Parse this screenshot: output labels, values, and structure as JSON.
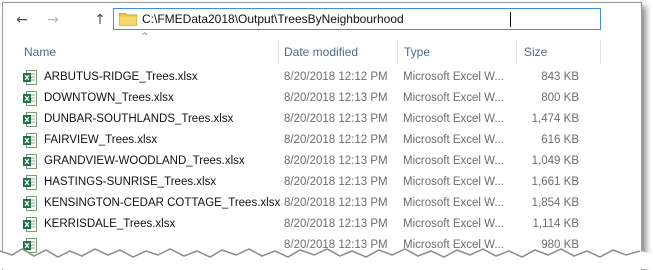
{
  "address": {
    "path": "C:\\FMEData2018\\Output\\TreesByNeighbourhood"
  },
  "nav": {
    "back": "←",
    "forward": "→",
    "up": "↑"
  },
  "columns": {
    "sort_indicator": "^",
    "name": "Name",
    "date": "Date modified",
    "type": "Type",
    "size": "Size"
  },
  "files": [
    {
      "name": "ARBUTUS-RIDGE_Trees.xlsx",
      "date": "8/20/2018 12:12 PM",
      "type": "Microsoft Excel W...",
      "size": "843 KB"
    },
    {
      "name": "DOWNTOWN_Trees.xlsx",
      "date": "8/20/2018 12:13 PM",
      "type": "Microsoft Excel W...",
      "size": "800 KB"
    },
    {
      "name": "DUNBAR-SOUTHLANDS_Trees.xlsx",
      "date": "8/20/2018 12:13 PM",
      "type": "Microsoft Excel W...",
      "size": "1,474 KB"
    },
    {
      "name": "FAIRVIEW_Trees.xlsx",
      "date": "8/20/2018 12:12 PM",
      "type": "Microsoft Excel W...",
      "size": "616 KB"
    },
    {
      "name": "GRANDVIEW-WOODLAND_Trees.xlsx",
      "date": "8/20/2018 12:13 PM",
      "type": "Microsoft Excel W...",
      "size": "1,049 KB"
    },
    {
      "name": "HASTINGS-SUNRISE_Trees.xlsx",
      "date": "8/20/2018 12:13 PM",
      "type": "Microsoft Excel W...",
      "size": "1,661 KB"
    },
    {
      "name": "KENSINGTON-CEDAR COTTAGE_Trees.xlsx",
      "date": "8/20/2018 12:13 PM",
      "type": "Microsoft Excel W...",
      "size": "1,854 KB"
    },
    {
      "name": "KERRISDALE_Trees.xlsx",
      "date": "8/20/2018 12:13 PM",
      "type": "Microsoft Excel W...",
      "size": "1,114 KB"
    },
    {
      "name": "",
      "date": "8/20/2018 12:13 PM",
      "type": "Microsoft Excel W...",
      "size": "980 KB"
    }
  ],
  "colors": {
    "excel_green": "#1e7145",
    "folder_yellow": "#f3c94c",
    "accent_blue": "#3d8ee6"
  },
  "icons": {
    "folder": "folder-icon",
    "excel": "excel-file-icon"
  }
}
